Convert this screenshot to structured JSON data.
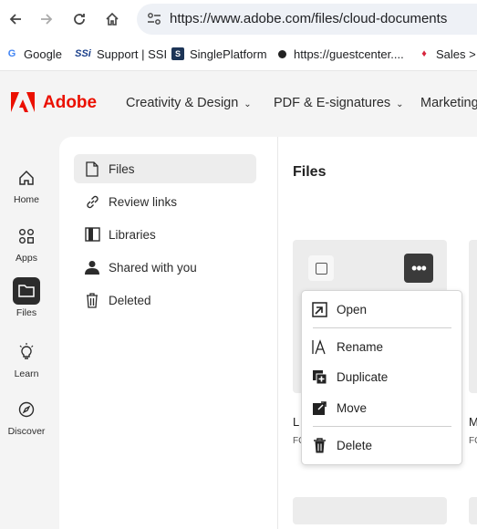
{
  "browser": {
    "url": "https://www.adobe.com/files/cloud-documents",
    "bookmarks": [
      {
        "label": "Google"
      },
      {
        "label": "Support | SSI"
      },
      {
        "label": "SinglePlatform"
      },
      {
        "label": "https://guestcenter...."
      },
      {
        "label": "Sales >"
      }
    ]
  },
  "header": {
    "brand": "Adobe",
    "nav": [
      "Creativity & Design",
      "PDF & E-signatures",
      "Marketing"
    ]
  },
  "rail": [
    {
      "label": "Home",
      "icon": "home-icon"
    },
    {
      "label": "Apps",
      "icon": "apps-icon"
    },
    {
      "label": "Files",
      "icon": "folder-icon"
    },
    {
      "label": "Learn",
      "icon": "lightbulb-icon"
    },
    {
      "label": "Discover",
      "icon": "compass-icon"
    }
  ],
  "panel": {
    "items": [
      {
        "label": "Files",
        "icon": "file-icon"
      },
      {
        "label": "Review links",
        "icon": "link-icon"
      },
      {
        "label": "Libraries",
        "icon": "library-icon"
      },
      {
        "label": "Shared with you",
        "icon": "people-icon"
      },
      {
        "label": "Deleted",
        "icon": "trash-icon"
      }
    ]
  },
  "main": {
    "title": "Files",
    "card_label_left": "L",
    "card_sub_left": "FC",
    "card_label_right": "M",
    "card_sub_right": "FC"
  },
  "menu": {
    "items": [
      {
        "label": "Open",
        "icon": "open-icon"
      },
      {
        "label": "Rename",
        "icon": "rename-icon"
      },
      {
        "label": "Duplicate",
        "icon": "duplicate-icon"
      },
      {
        "label": "Move",
        "icon": "move-icon"
      },
      {
        "label": "Delete",
        "icon": "trash-icon"
      }
    ]
  },
  "colors": {
    "adobe_red": "#eb1000",
    "active_rail": "#2c2c2c",
    "more_button": "#3a3a3a"
  }
}
